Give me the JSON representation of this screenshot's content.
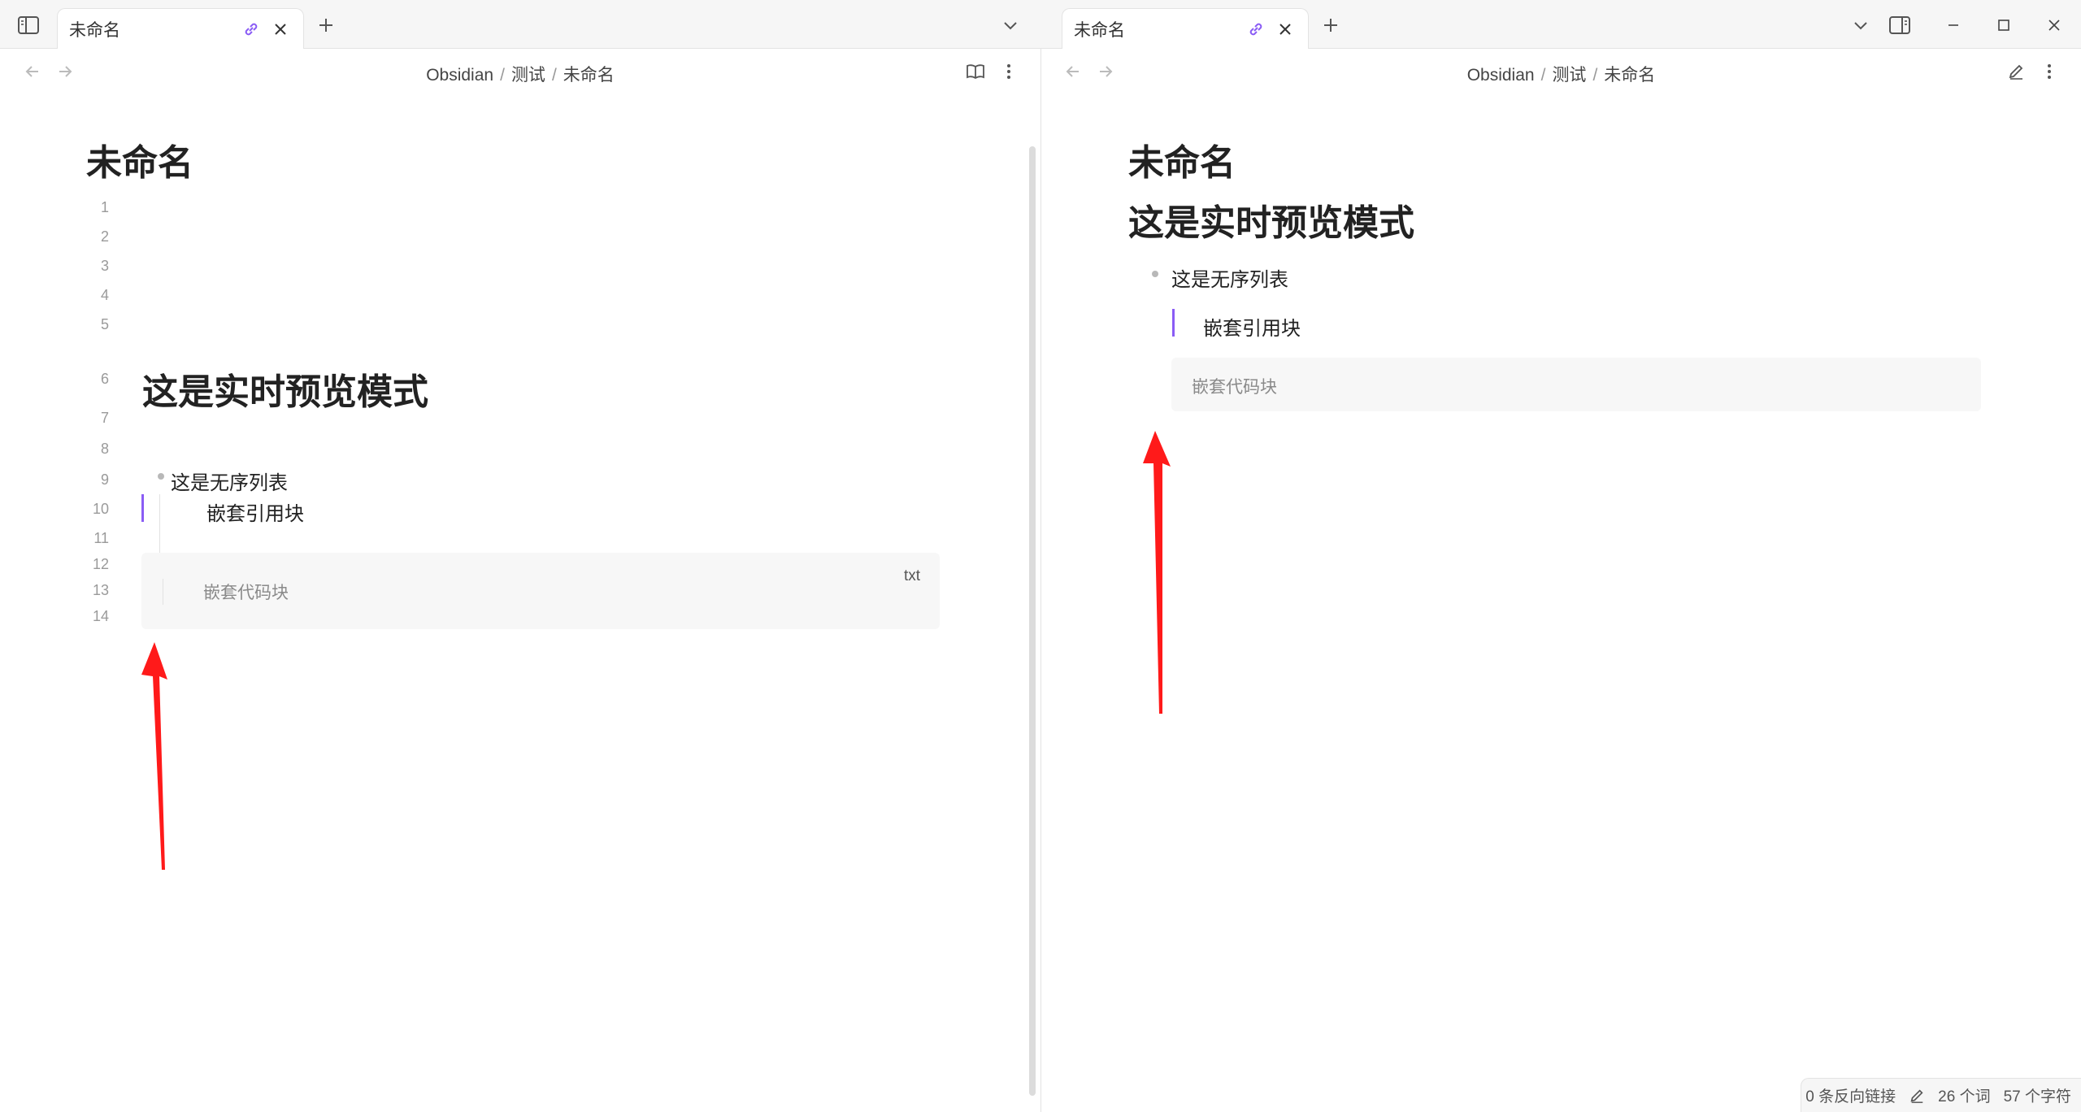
{
  "tabs": {
    "left": {
      "title": "未命名"
    },
    "right": {
      "title": "未命名"
    }
  },
  "breadcrumb": {
    "vault": "Obsidian",
    "folder": "测试",
    "note": "未命名",
    "separator": "/"
  },
  "left_pane": {
    "title": "未命名",
    "line_numbers": [
      "1",
      "2",
      "3",
      "4",
      "5",
      "6",
      "7",
      "8",
      "9",
      "10",
      "11",
      "12",
      "13",
      "14"
    ],
    "heading": "这是实时预览模式",
    "list_item": "这是无序列表",
    "quote": "嵌套引用块",
    "code": "嵌套代码块",
    "code_lang": "txt"
  },
  "right_pane": {
    "title": "未命名",
    "heading": "这是实时预览模式",
    "list_item": "这是无序列表",
    "quote": "嵌套引用块",
    "code": "嵌套代码块"
  },
  "status_bar": {
    "backlinks": "0 条反向链接",
    "words": "26 个词",
    "chars": "57 个字符"
  },
  "icons": {
    "sidebar_toggle": "sidebar-toggle-icon",
    "link": "link-icon",
    "close": "close-icon",
    "new_tab": "plus-icon",
    "tab_list": "chevron-down-icon",
    "right_sidebar": "right-sidebar-icon",
    "minimize": "minimize-icon",
    "maximize": "maximize-icon",
    "window_close": "window-close-icon",
    "back": "arrow-left-icon",
    "forward": "arrow-right-icon",
    "reading_view": "book-open-icon",
    "edit_view": "pencil-icon",
    "more": "more-vertical-icon"
  },
  "colors": {
    "accent": "#8a5cf5",
    "arrow": "#ff0000"
  }
}
